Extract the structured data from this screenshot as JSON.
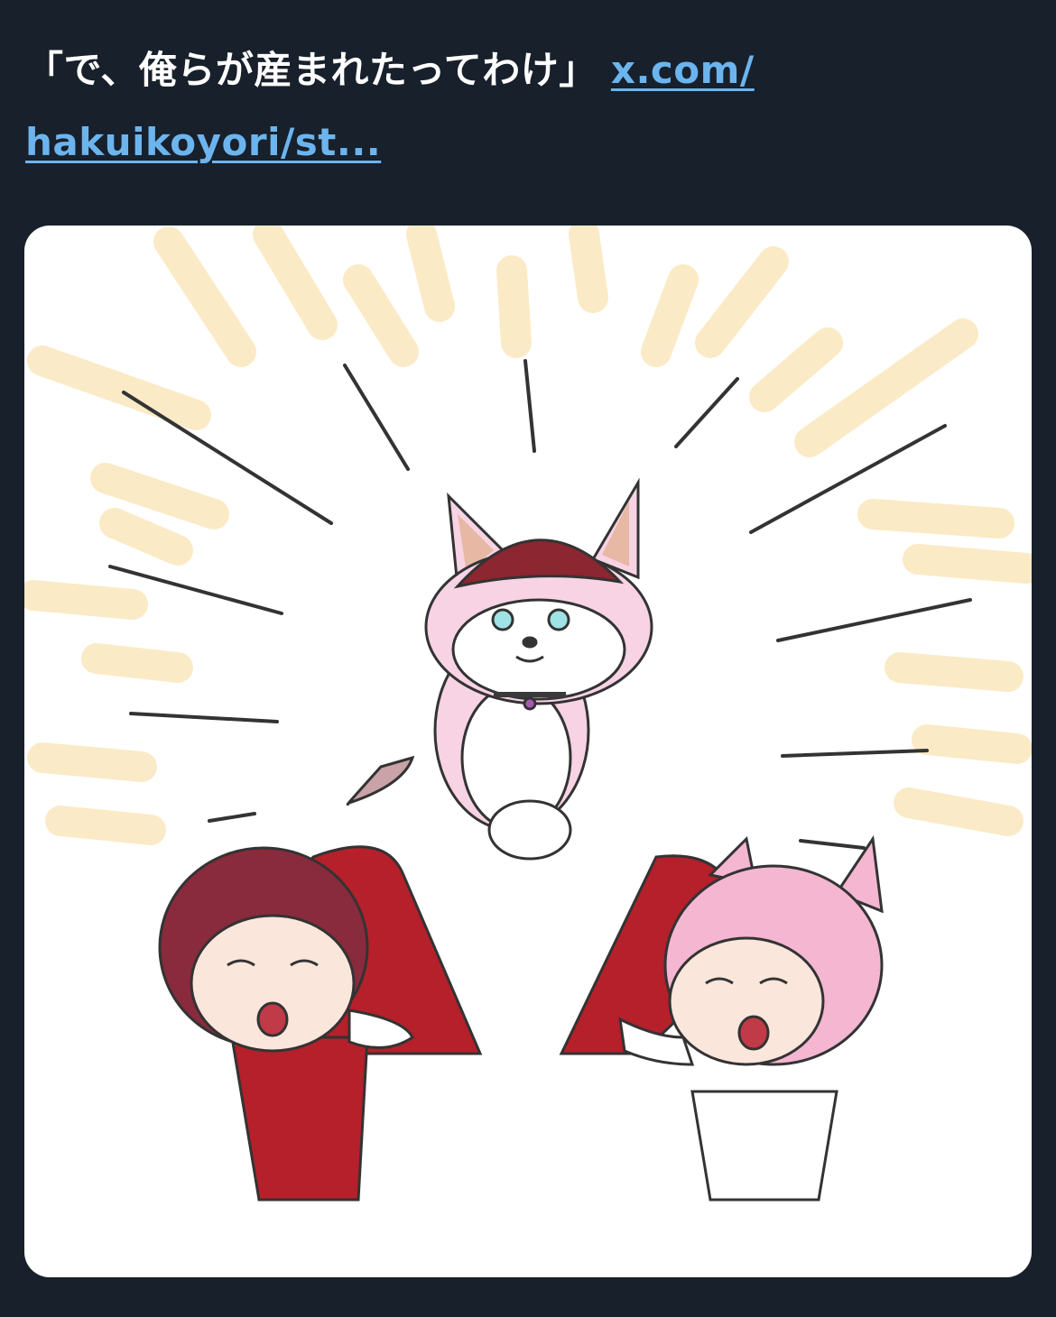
{
  "post": {
    "text": "「で、俺らが産まれたってわけ」",
    "link_line1": "x.com/",
    "link_line2": "hakuikoyori/st..."
  },
  "media": {
    "type": "illustration"
  },
  "colors": {
    "background": "#17202b",
    "link": "#6cb4ee",
    "card": "#ffffff",
    "heart_red": "#b5202a",
    "glow": "#fbe9c4"
  }
}
